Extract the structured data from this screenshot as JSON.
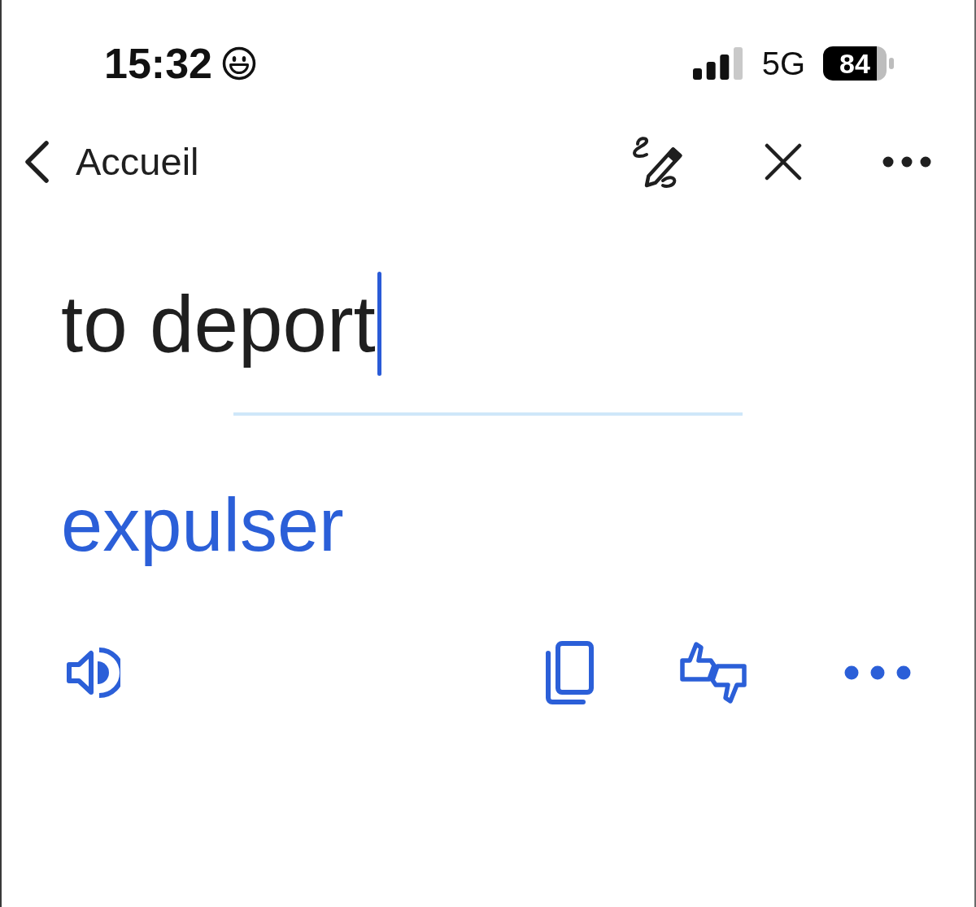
{
  "status_bar": {
    "time": "15:32",
    "network": "5G",
    "battery": "84"
  },
  "nav": {
    "back_label": "Accueil"
  },
  "source": {
    "value": "to deport"
  },
  "translation": {
    "text": "expulser"
  }
}
